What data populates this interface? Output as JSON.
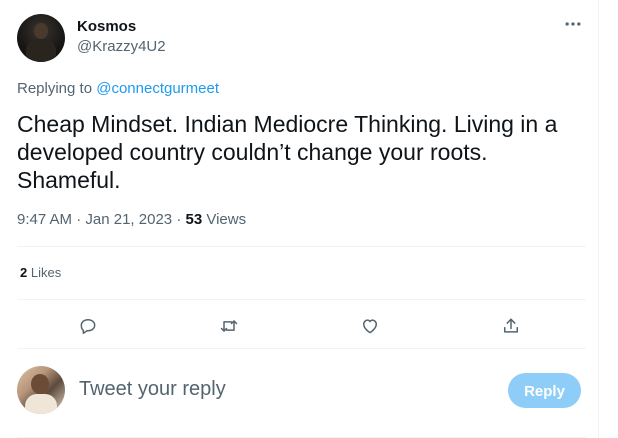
{
  "tweet": {
    "author_name": "Kosmos",
    "author_handle": "@Krazzy4U2",
    "more_icon": "more-horizontal-icon",
    "replying_prefix": "Replying to",
    "replying_to": "@connectgurmeet",
    "text": "Cheap Mindset. Indian Mediocre Thinking. Living in a developed country couldn’t change your roots. Shameful.",
    "time": "9:47 AM",
    "separator": "·",
    "date": "Jan 21, 2023",
    "views_count": "53",
    "views_label": "Views",
    "likes_count": "2",
    "likes_label": "Likes"
  },
  "actions": [
    {
      "name": "reply",
      "icon": "comment-icon"
    },
    {
      "name": "retweet",
      "icon": "retweet-icon"
    },
    {
      "name": "like",
      "icon": "heart-icon"
    },
    {
      "name": "share",
      "icon": "share-icon"
    }
  ],
  "composer": {
    "placeholder": "Tweet your reply",
    "button_label": "Reply"
  },
  "colors": {
    "text": "#0f1419",
    "secondary": "#536471",
    "accent": "#1d9bf0",
    "reply_button_disabled": "#8ecdf8",
    "divider": "#eff3f4"
  }
}
